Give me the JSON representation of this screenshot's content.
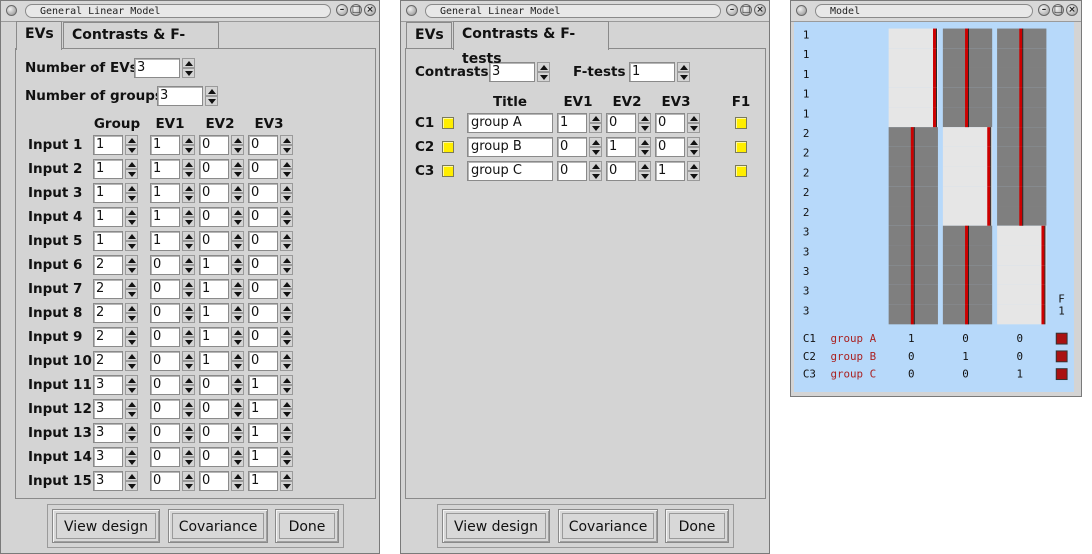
{
  "window1": {
    "title": "General Linear Model",
    "tabs": [
      "EVs",
      "Contrasts & F-tests"
    ],
    "active_tab": "EVs",
    "num_evs_label": "Number of EVs",
    "num_evs_value": "3",
    "num_groups_label": "Number of groups",
    "num_groups_value": "3",
    "columns": [
      "Group",
      "EV1",
      "EV2",
      "EV3"
    ],
    "rows": [
      {
        "label": "Input 1",
        "group": "1",
        "ev1": "1",
        "ev2": "0",
        "ev3": "0"
      },
      {
        "label": "Input 2",
        "group": "1",
        "ev1": "1",
        "ev2": "0",
        "ev3": "0"
      },
      {
        "label": "Input 3",
        "group": "1",
        "ev1": "1",
        "ev2": "0",
        "ev3": "0"
      },
      {
        "label": "Input 4",
        "group": "1",
        "ev1": "1",
        "ev2": "0",
        "ev3": "0"
      },
      {
        "label": "Input 5",
        "group": "1",
        "ev1": "1",
        "ev2": "0",
        "ev3": "0"
      },
      {
        "label": "Input 6",
        "group": "2",
        "ev1": "0",
        "ev2": "1",
        "ev3": "0"
      },
      {
        "label": "Input 7",
        "group": "2",
        "ev1": "0",
        "ev2": "1",
        "ev3": "0"
      },
      {
        "label": "Input 8",
        "group": "2",
        "ev1": "0",
        "ev2": "1",
        "ev3": "0"
      },
      {
        "label": "Input 9",
        "group": "2",
        "ev1": "0",
        "ev2": "1",
        "ev3": "0"
      },
      {
        "label": "Input 10",
        "group": "2",
        "ev1": "0",
        "ev2": "1",
        "ev3": "0"
      },
      {
        "label": "Input 11",
        "group": "3",
        "ev1": "0",
        "ev2": "0",
        "ev3": "1"
      },
      {
        "label": "Input 12",
        "group": "3",
        "ev1": "0",
        "ev2": "0",
        "ev3": "1"
      },
      {
        "label": "Input 13",
        "group": "3",
        "ev1": "0",
        "ev2": "0",
        "ev3": "1"
      },
      {
        "label": "Input 14",
        "group": "3",
        "ev1": "0",
        "ev2": "0",
        "ev3": "1"
      },
      {
        "label": "Input 15",
        "group": "3",
        "ev1": "0",
        "ev2": "0",
        "ev3": "1"
      }
    ],
    "buttons": {
      "view_design": "View design",
      "covariance": "Covariance",
      "done": "Done"
    }
  },
  "window2": {
    "title": "General Linear Model",
    "tabs": [
      "EVs",
      "Contrasts & F-tests"
    ],
    "active_tab": "Contrasts & F-tests",
    "contrasts_label": "Contrasts",
    "contrasts_value": "3",
    "ftests_label": "F-tests",
    "ftests_value": "1",
    "columns": [
      "Title",
      "EV1",
      "EV2",
      "EV3",
      "F1"
    ],
    "contrasts": [
      {
        "label": "C1",
        "title": "group A",
        "ev1": "1",
        "ev2": "0",
        "ev3": "0"
      },
      {
        "label": "C2",
        "title": "group B",
        "ev1": "0",
        "ev2": "1",
        "ev3": "0"
      },
      {
        "label": "C3",
        "title": "group C",
        "ev1": "0",
        "ev2": "0",
        "ev3": "1"
      }
    ],
    "buttons": {
      "view_design": "View design",
      "covariance": "Covariance",
      "done": "Done"
    }
  },
  "window3": {
    "title": "Model",
    "row_groups": [
      "1",
      "1",
      "1",
      "1",
      "1",
      "2",
      "2",
      "2",
      "2",
      "2",
      "3",
      "3",
      "3",
      "3",
      "3"
    ],
    "f_label": "F",
    "f_index": "1",
    "contrasts": [
      {
        "label": "C1",
        "title": "group A",
        "values": [
          "1",
          "0",
          "0"
        ]
      },
      {
        "label": "C2",
        "title": "group B",
        "values": [
          "0",
          "1",
          "0"
        ]
      },
      {
        "label": "C3",
        "title": "group C",
        "values": [
          "0",
          "0",
          "1"
        ]
      }
    ],
    "design_matrix": [
      [
        1,
        0,
        0
      ],
      [
        1,
        0,
        0
      ],
      [
        1,
        0,
        0
      ],
      [
        1,
        0,
        0
      ],
      [
        1,
        0,
        0
      ],
      [
        0,
        1,
        0
      ],
      [
        0,
        1,
        0
      ],
      [
        0,
        1,
        0
      ],
      [
        0,
        1,
        0
      ],
      [
        0,
        1,
        0
      ],
      [
        0,
        0,
        1
      ],
      [
        0,
        0,
        1
      ],
      [
        0,
        0,
        1
      ],
      [
        0,
        0,
        1
      ],
      [
        0,
        0,
        1
      ]
    ],
    "colors": {
      "background": "#b7d9fa",
      "high": "#e6e6e6",
      "low": "#7f7f7f",
      "line": "#cc0000",
      "text_red": "#aa2222",
      "f_box": "#aa1111"
    }
  }
}
